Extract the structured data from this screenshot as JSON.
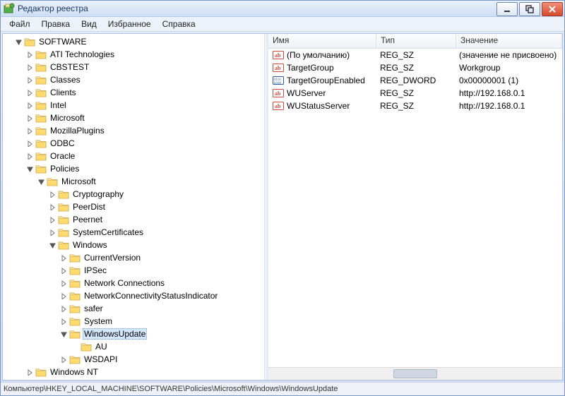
{
  "window": {
    "title": "Редактор реестра"
  },
  "menu": {
    "file": "Файл",
    "edit": "Правка",
    "view": "Вид",
    "favorites": "Избранное",
    "help": "Справка"
  },
  "status": {
    "path": "Компьютер\\HKEY_LOCAL_MACHINE\\SOFTWARE\\Policies\\Microsoft\\Windows\\WindowsUpdate"
  },
  "columns": {
    "name": "Имя",
    "type": "Тип",
    "value": "Значение"
  },
  "values": [
    {
      "icon": "string",
      "name": "(По умолчанию)",
      "type": "REG_SZ",
      "data": "(значение не присвоено)"
    },
    {
      "icon": "string",
      "name": "TargetGroup",
      "type": "REG_SZ",
      "data": "Workgroup"
    },
    {
      "icon": "binary",
      "name": "TargetGroupEnabled",
      "type": "REG_DWORD",
      "data": "0x00000001 (1)"
    },
    {
      "icon": "string",
      "name": "WUServer",
      "type": "REG_SZ",
      "data": "http://192.168.0.1"
    },
    {
      "icon": "string",
      "name": "WUStatusServer",
      "type": "REG_SZ",
      "data": "http://192.168.0.1"
    }
  ],
  "tree": {
    "root": "SOFTWARE",
    "children": [
      {
        "label": "ATI Technologies"
      },
      {
        "label": "CBSTEST"
      },
      {
        "label": "Classes"
      },
      {
        "label": "Clients"
      },
      {
        "label": "Intel"
      },
      {
        "label": "Microsoft"
      },
      {
        "label": "MozillaPlugins"
      },
      {
        "label": "ODBC"
      },
      {
        "label": "Oracle"
      },
      {
        "label": "Policies",
        "expanded": true,
        "children": [
          {
            "label": "Microsoft",
            "expanded": true,
            "children": [
              {
                "label": "Cryptography"
              },
              {
                "label": "PeerDist"
              },
              {
                "label": "Peernet"
              },
              {
                "label": "SystemCertificates"
              },
              {
                "label": "Windows",
                "expanded": true,
                "children": [
                  {
                    "label": "CurrentVersion"
                  },
                  {
                    "label": "IPSec"
                  },
                  {
                    "label": "Network Connections"
                  },
                  {
                    "label": "NetworkConnectivityStatusIndicator"
                  },
                  {
                    "label": "safer"
                  },
                  {
                    "label": "System"
                  },
                  {
                    "label": "WindowsUpdate",
                    "expanded": true,
                    "selected": true,
                    "children": [
                      {
                        "label": "AU",
                        "leaf": true
                      }
                    ]
                  },
                  {
                    "label": "WSDAPI"
                  }
                ]
              }
            ]
          }
        ]
      },
      {
        "label": "Windows NT"
      }
    ]
  }
}
